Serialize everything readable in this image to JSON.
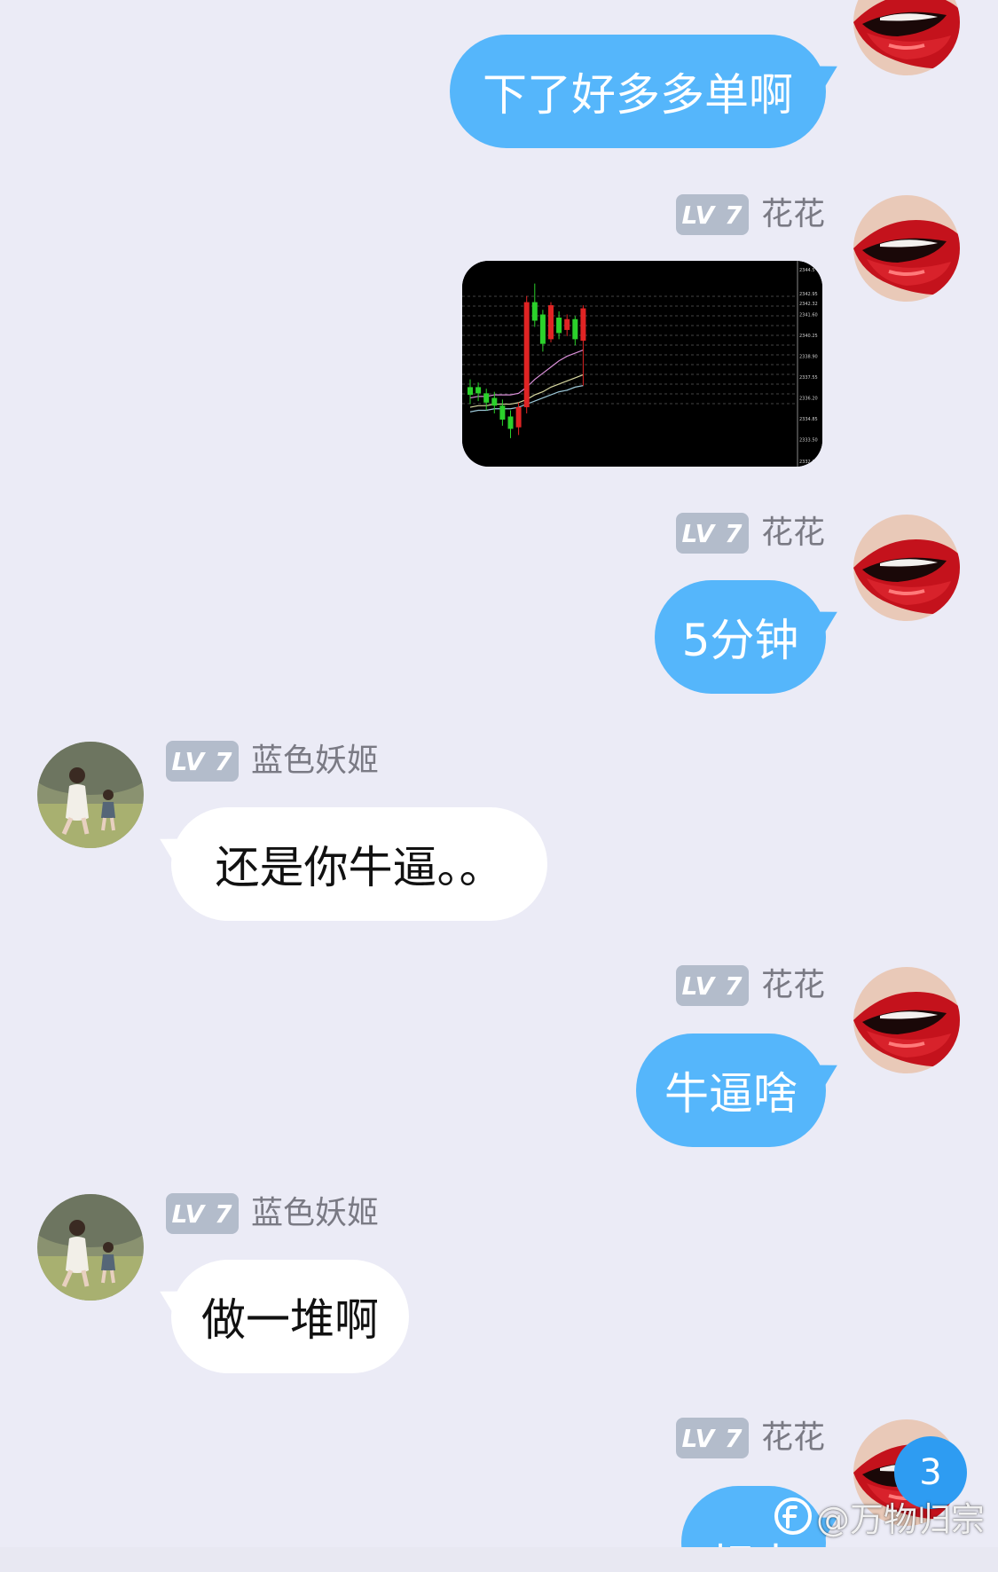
{
  "colors": {
    "background": "#ebebf6",
    "outgoing_bubble": "#55b6fb",
    "incoming_bubble": "#ffffff",
    "lv_badge": "#b3bccb",
    "unread_badge": "#2e9cf2"
  },
  "messages": [
    {
      "direction": "out",
      "sender": "",
      "level": "",
      "text": "下了好多多单啊"
    },
    {
      "direction": "out",
      "sender": "花花",
      "level": "LV 7",
      "type": "image"
    },
    {
      "direction": "out",
      "sender": "花花",
      "level": "LV 7",
      "text": "5分钟"
    },
    {
      "direction": "in",
      "sender": "蓝色妖姬",
      "level": "LV 7",
      "text": "还是你牛逼。。"
    },
    {
      "direction": "out",
      "sender": "花花",
      "level": "LV 7",
      "text": "牛逼啥"
    },
    {
      "direction": "in",
      "sender": "蓝色妖姬",
      "level": "LV 7",
      "text": "做一堆啊"
    },
    {
      "direction": "out",
      "sender": "花花",
      "level": "LV 7",
      "text": "相去"
    }
  ],
  "chart_data": {
    "type": "candlestick",
    "y_tick_labels": [
      "2344.5",
      "2342.95",
      "2342.32",
      "2341.60",
      "2340.25",
      "2338.90",
      "2337.55",
      "2336.20",
      "2334.85",
      "2333.50",
      "2332.1"
    ],
    "ylim": [
      2332.1,
      2344.5
    ],
    "candles": [
      {
        "o": 2336.4,
        "c": 2336.9,
        "h": 2337.4,
        "l": 2335.8,
        "color": "green"
      },
      {
        "o": 2336.9,
        "c": 2336.5,
        "h": 2337.2,
        "l": 2336.0,
        "color": "green"
      },
      {
        "o": 2336.5,
        "c": 2335.9,
        "h": 2336.8,
        "l": 2335.4,
        "color": "green"
      },
      {
        "o": 2336.2,
        "c": 2335.7,
        "h": 2336.6,
        "l": 2335.2,
        "color": "green"
      },
      {
        "o": 2335.7,
        "c": 2334.8,
        "h": 2336.1,
        "l": 2334.4,
        "color": "green"
      },
      {
        "o": 2335.0,
        "c": 2334.2,
        "h": 2335.4,
        "l": 2333.6,
        "color": "green"
      },
      {
        "o": 2334.3,
        "c": 2335.6,
        "h": 2335.9,
        "l": 2333.8,
        "color": "red"
      },
      {
        "o": 2335.6,
        "c": 2342.4,
        "h": 2342.8,
        "l": 2335.2,
        "color": "red"
      },
      {
        "o": 2342.4,
        "c": 2341.2,
        "h": 2343.6,
        "l": 2340.8,
        "color": "green"
      },
      {
        "o": 2341.6,
        "c": 2339.7,
        "h": 2341.9,
        "l": 2339.2,
        "color": "green"
      },
      {
        "o": 2340.0,
        "c": 2342.2,
        "h": 2342.4,
        "l": 2339.8,
        "color": "red"
      },
      {
        "o": 2341.4,
        "c": 2340.4,
        "h": 2341.8,
        "l": 2340.0,
        "color": "green"
      },
      {
        "o": 2340.6,
        "c": 2341.3,
        "h": 2341.6,
        "l": 2340.2,
        "color": "red"
      },
      {
        "o": 2341.3,
        "c": 2340.0,
        "h": 2341.5,
        "l": 2339.6,
        "color": "green"
      },
      {
        "o": 2339.9,
        "c": 2342.0,
        "h": 2342.2,
        "l": 2337.0,
        "color": "red"
      }
    ],
    "moving_averages": [
      {
        "name": "",
        "color": "#d98fd8",
        "values": [
          2336.2,
          2336.3,
          2336.3,
          2336.4,
          2336.4,
          2336.4,
          2336.5,
          2336.9,
          2337.4,
          2337.8,
          2338.2,
          2338.6,
          2338.9,
          2339.1,
          2339.3
        ]
      },
      {
        "name": "",
        "color": "#d8d8a0",
        "values": [
          2335.6,
          2335.7,
          2335.7,
          2335.8,
          2335.8,
          2335.8,
          2335.9,
          2336.1,
          2336.4,
          2336.6,
          2336.9,
          2337.1,
          2337.3,
          2337.5,
          2337.7
        ]
      },
      {
        "name": "",
        "color": "#9cc8d8",
        "values": [
          2335.3,
          2335.4,
          2335.4,
          2335.5,
          2335.5,
          2335.5,
          2335.6,
          2335.8,
          2336.0,
          2336.2,
          2336.4,
          2336.6,
          2336.7,
          2336.9,
          2337.0
        ]
      }
    ],
    "grid": true,
    "background": "#000000",
    "up_color": "#e02424",
    "down_color": "#2bd12b"
  },
  "unread_badge": "3",
  "watermark": "@万物归宗"
}
